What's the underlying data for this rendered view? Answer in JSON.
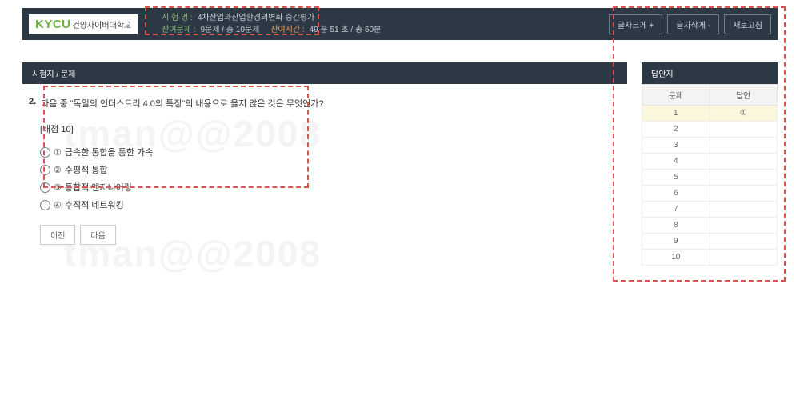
{
  "logo": {
    "main": "KYCU",
    "sub": "건양사이버대학교"
  },
  "header": {
    "exam_label": "시 험 명 :",
    "exam_name": "4차산업과산업환경의변화 중간평가",
    "remain_q_label": "잔여문제 :",
    "remain_q": "9문제 / 총 10문제",
    "remain_t_label": "잔여시간 :",
    "remain_t": "49 분 51 초 / 총 50분"
  },
  "buttons": {
    "font_up": "글자크게 +",
    "font_down": "글자작게 -",
    "refresh": "새로고침",
    "prev": "이전",
    "next": "다음"
  },
  "section": {
    "main": "시험지 / 문제",
    "side": "답안지"
  },
  "question": {
    "num": "2.",
    "text": "다음 중 \"독일의 인더스트리 4.0의 특징\"의 내용으로 옳지 않은 것은 무엇인가?",
    "points": "[배점 10]",
    "opts": [
      {
        "c": "①",
        "t": "급속한 통합을 통한 가속"
      },
      {
        "c": "②",
        "t": "수평적 통합"
      },
      {
        "c": "③",
        "t": "통합적 엔지니어링"
      },
      {
        "c": "④",
        "t": "수직적 네트워킹"
      }
    ]
  },
  "answer_sheet": {
    "col_q": "문제",
    "col_a": "답안",
    "rows": [
      {
        "n": "1",
        "a": "①",
        "cur": true
      },
      {
        "n": "2",
        "a": "",
        "cur": false
      },
      {
        "n": "3",
        "a": "",
        "cur": false
      },
      {
        "n": "4",
        "a": "",
        "cur": false
      },
      {
        "n": "5",
        "a": "",
        "cur": false
      },
      {
        "n": "6",
        "a": "",
        "cur": false
      },
      {
        "n": "7",
        "a": "",
        "cur": false
      },
      {
        "n": "8",
        "a": "",
        "cur": false
      },
      {
        "n": "9",
        "a": "",
        "cur": false
      },
      {
        "n": "10",
        "a": "",
        "cur": false
      }
    ]
  },
  "watermark": "tman@@2008"
}
